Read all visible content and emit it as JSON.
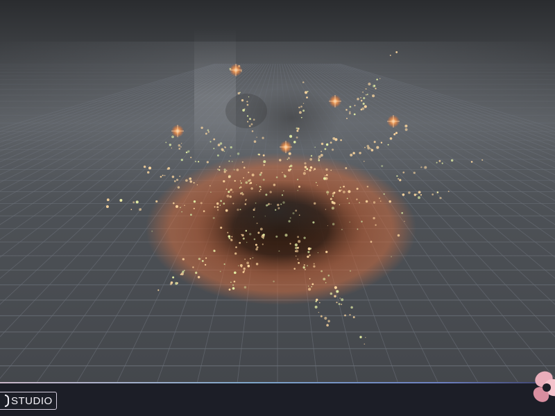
{
  "app": {
    "brand_label": "STUDIO"
  },
  "icons": {
    "brand_mark": "studio-logo-mark-icon",
    "corner_logo": "pink-petal-logo-icon"
  },
  "scene": {
    "subject": "explosion-particle-effect",
    "environment": "perspective-grid-floor"
  },
  "colors": {
    "grid_line": "#6b7079",
    "background_top": "#2b2d30",
    "background_horizon": "#5a5e63",
    "fire": "#e8713a",
    "spark": "#ffd9a0",
    "bottom_bar": "#1c1e27",
    "brand_accent": "#e9aebb"
  }
}
